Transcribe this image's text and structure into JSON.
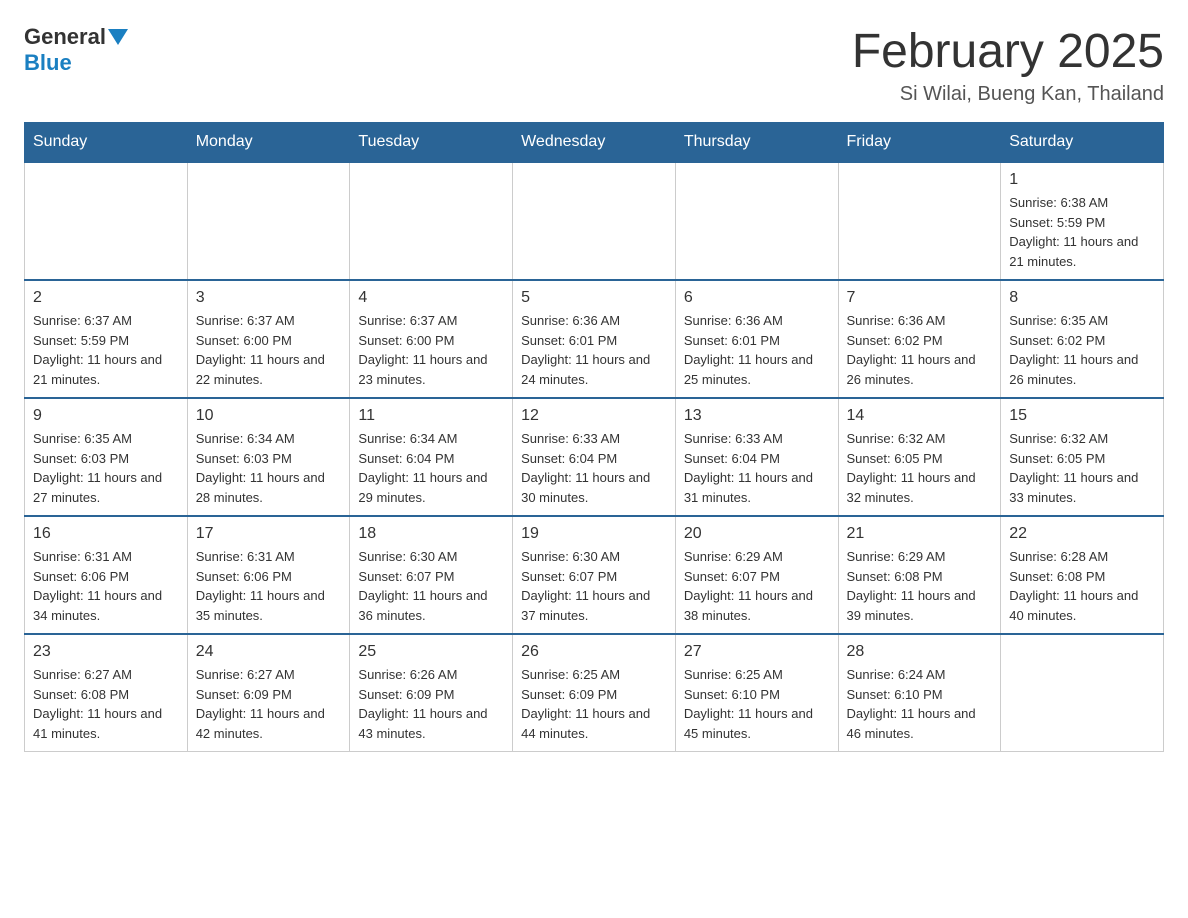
{
  "logo": {
    "general": "General",
    "blue": "Blue"
  },
  "title": "February 2025",
  "subtitle": "Si Wilai, Bueng Kan, Thailand",
  "days_header": [
    "Sunday",
    "Monday",
    "Tuesday",
    "Wednesday",
    "Thursday",
    "Friday",
    "Saturday"
  ],
  "weeks": [
    [
      {
        "day": "",
        "sunrise": "",
        "sunset": "",
        "daylight": ""
      },
      {
        "day": "",
        "sunrise": "",
        "sunset": "",
        "daylight": ""
      },
      {
        "day": "",
        "sunrise": "",
        "sunset": "",
        "daylight": ""
      },
      {
        "day": "",
        "sunrise": "",
        "sunset": "",
        "daylight": ""
      },
      {
        "day": "",
        "sunrise": "",
        "sunset": "",
        "daylight": ""
      },
      {
        "day": "",
        "sunrise": "",
        "sunset": "",
        "daylight": ""
      },
      {
        "day": "1",
        "sunrise": "Sunrise: 6:38 AM",
        "sunset": "Sunset: 5:59 PM",
        "daylight": "Daylight: 11 hours and 21 minutes."
      }
    ],
    [
      {
        "day": "2",
        "sunrise": "Sunrise: 6:37 AM",
        "sunset": "Sunset: 5:59 PM",
        "daylight": "Daylight: 11 hours and 21 minutes."
      },
      {
        "day": "3",
        "sunrise": "Sunrise: 6:37 AM",
        "sunset": "Sunset: 6:00 PM",
        "daylight": "Daylight: 11 hours and 22 minutes."
      },
      {
        "day": "4",
        "sunrise": "Sunrise: 6:37 AM",
        "sunset": "Sunset: 6:00 PM",
        "daylight": "Daylight: 11 hours and 23 minutes."
      },
      {
        "day": "5",
        "sunrise": "Sunrise: 6:36 AM",
        "sunset": "Sunset: 6:01 PM",
        "daylight": "Daylight: 11 hours and 24 minutes."
      },
      {
        "day": "6",
        "sunrise": "Sunrise: 6:36 AM",
        "sunset": "Sunset: 6:01 PM",
        "daylight": "Daylight: 11 hours and 25 minutes."
      },
      {
        "day": "7",
        "sunrise": "Sunrise: 6:36 AM",
        "sunset": "Sunset: 6:02 PM",
        "daylight": "Daylight: 11 hours and 26 minutes."
      },
      {
        "day": "8",
        "sunrise": "Sunrise: 6:35 AM",
        "sunset": "Sunset: 6:02 PM",
        "daylight": "Daylight: 11 hours and 26 minutes."
      }
    ],
    [
      {
        "day": "9",
        "sunrise": "Sunrise: 6:35 AM",
        "sunset": "Sunset: 6:03 PM",
        "daylight": "Daylight: 11 hours and 27 minutes."
      },
      {
        "day": "10",
        "sunrise": "Sunrise: 6:34 AM",
        "sunset": "Sunset: 6:03 PM",
        "daylight": "Daylight: 11 hours and 28 minutes."
      },
      {
        "day": "11",
        "sunrise": "Sunrise: 6:34 AM",
        "sunset": "Sunset: 6:04 PM",
        "daylight": "Daylight: 11 hours and 29 minutes."
      },
      {
        "day": "12",
        "sunrise": "Sunrise: 6:33 AM",
        "sunset": "Sunset: 6:04 PM",
        "daylight": "Daylight: 11 hours and 30 minutes."
      },
      {
        "day": "13",
        "sunrise": "Sunrise: 6:33 AM",
        "sunset": "Sunset: 6:04 PM",
        "daylight": "Daylight: 11 hours and 31 minutes."
      },
      {
        "day": "14",
        "sunrise": "Sunrise: 6:32 AM",
        "sunset": "Sunset: 6:05 PM",
        "daylight": "Daylight: 11 hours and 32 minutes."
      },
      {
        "day": "15",
        "sunrise": "Sunrise: 6:32 AM",
        "sunset": "Sunset: 6:05 PM",
        "daylight": "Daylight: 11 hours and 33 minutes."
      }
    ],
    [
      {
        "day": "16",
        "sunrise": "Sunrise: 6:31 AM",
        "sunset": "Sunset: 6:06 PM",
        "daylight": "Daylight: 11 hours and 34 minutes."
      },
      {
        "day": "17",
        "sunrise": "Sunrise: 6:31 AM",
        "sunset": "Sunset: 6:06 PM",
        "daylight": "Daylight: 11 hours and 35 minutes."
      },
      {
        "day": "18",
        "sunrise": "Sunrise: 6:30 AM",
        "sunset": "Sunset: 6:07 PM",
        "daylight": "Daylight: 11 hours and 36 minutes."
      },
      {
        "day": "19",
        "sunrise": "Sunrise: 6:30 AM",
        "sunset": "Sunset: 6:07 PM",
        "daylight": "Daylight: 11 hours and 37 minutes."
      },
      {
        "day": "20",
        "sunrise": "Sunrise: 6:29 AM",
        "sunset": "Sunset: 6:07 PM",
        "daylight": "Daylight: 11 hours and 38 minutes."
      },
      {
        "day": "21",
        "sunrise": "Sunrise: 6:29 AM",
        "sunset": "Sunset: 6:08 PM",
        "daylight": "Daylight: 11 hours and 39 minutes."
      },
      {
        "day": "22",
        "sunrise": "Sunrise: 6:28 AM",
        "sunset": "Sunset: 6:08 PM",
        "daylight": "Daylight: 11 hours and 40 minutes."
      }
    ],
    [
      {
        "day": "23",
        "sunrise": "Sunrise: 6:27 AM",
        "sunset": "Sunset: 6:08 PM",
        "daylight": "Daylight: 11 hours and 41 minutes."
      },
      {
        "day": "24",
        "sunrise": "Sunrise: 6:27 AM",
        "sunset": "Sunset: 6:09 PM",
        "daylight": "Daylight: 11 hours and 42 minutes."
      },
      {
        "day": "25",
        "sunrise": "Sunrise: 6:26 AM",
        "sunset": "Sunset: 6:09 PM",
        "daylight": "Daylight: 11 hours and 43 minutes."
      },
      {
        "day": "26",
        "sunrise": "Sunrise: 6:25 AM",
        "sunset": "Sunset: 6:09 PM",
        "daylight": "Daylight: 11 hours and 44 minutes."
      },
      {
        "day": "27",
        "sunrise": "Sunrise: 6:25 AM",
        "sunset": "Sunset: 6:10 PM",
        "daylight": "Daylight: 11 hours and 45 minutes."
      },
      {
        "day": "28",
        "sunrise": "Sunrise: 6:24 AM",
        "sunset": "Sunset: 6:10 PM",
        "daylight": "Daylight: 11 hours and 46 minutes."
      },
      {
        "day": "",
        "sunrise": "",
        "sunset": "",
        "daylight": ""
      }
    ]
  ]
}
